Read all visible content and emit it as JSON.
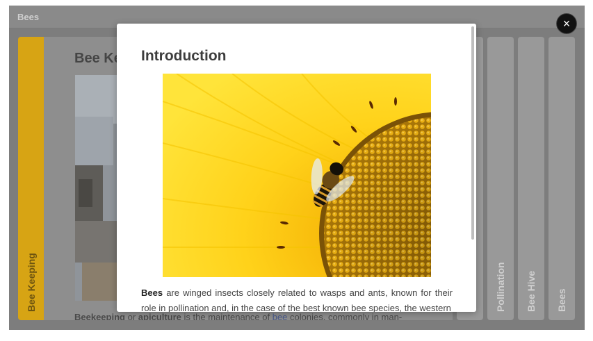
{
  "app": {
    "title": "Bees"
  },
  "panels": {
    "active": "Bee Keeping",
    "collapsed": [
      "Pollination",
      "Bee Hive",
      "Bees"
    ]
  },
  "content": {
    "heading": "Bee Ke",
    "text_bold1": "Beekeeping",
    "text_or": " or ",
    "text_bold2": "apiculture",
    "text_mid": " is the maintenance of ",
    "text_link": "bee",
    "text_end": " colonies, commonly in man-"
  },
  "modal": {
    "title": "Introduction",
    "close_icon": "×",
    "text_bold": "Bees",
    "text": " are winged insects closely related to wasps and ants, known for their role in pollination and, in the case of the best known bee species, the western"
  }
}
